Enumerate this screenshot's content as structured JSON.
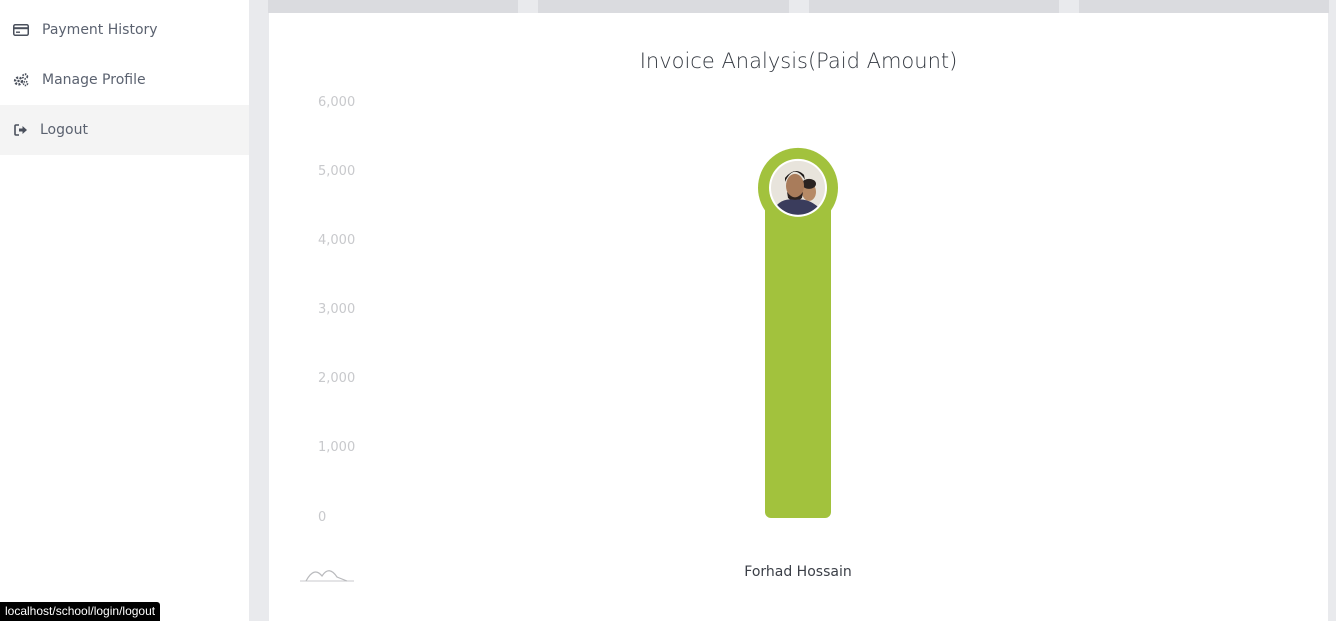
{
  "sidebar": {
    "items": [
      {
        "label": "Payment History",
        "icon": "credit-card-icon"
      },
      {
        "label": "Manage Profile",
        "icon": "gears-icon"
      },
      {
        "label": "Logout",
        "icon": "sign-out-icon",
        "active": true
      }
    ]
  },
  "status_bar": {
    "url": "localhost/school/login/logout"
  },
  "chart_data": {
    "type": "bar",
    "title": "Invoice Analysis(Paid Amount)",
    "categories": [
      "Forhad Hossain"
    ],
    "values": [
      4600
    ],
    "ylim": [
      0,
      6000
    ],
    "yticks": [
      "0",
      "1,000",
      "2,000",
      "3,000",
      "4,000",
      "5,000",
      "6,000"
    ],
    "bar_color": "#a2c23d",
    "legend": "none",
    "grid": false
  }
}
